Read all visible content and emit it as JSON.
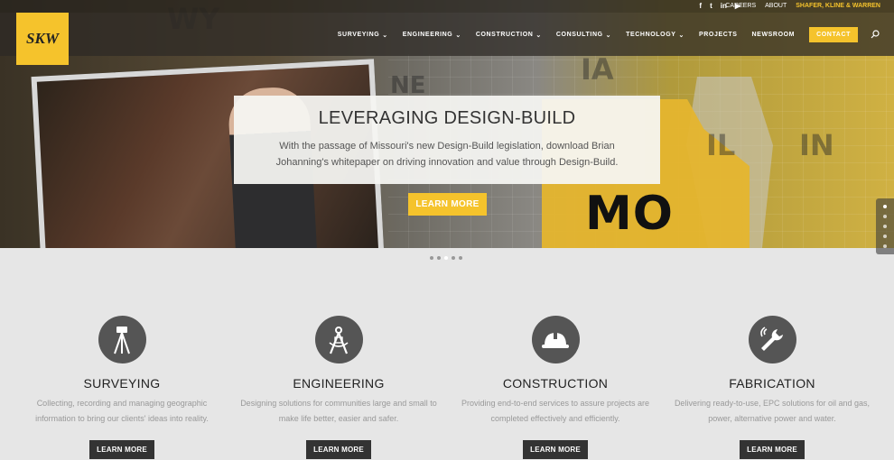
{
  "header": {
    "social_icons": [
      "facebook-icon",
      "twitter-icon",
      "linkedin-icon",
      "youtube-icon"
    ],
    "social_glyphs": [
      "f",
      "t",
      "in",
      "▶"
    ],
    "top_links": [
      "CAREERS",
      "ABOUT",
      "SHAFER, KLINE & WARREN"
    ],
    "logo_text": "SKW",
    "nav": [
      {
        "label": "SURVEYING",
        "dropdown": true
      },
      {
        "label": "ENGINEERING",
        "dropdown": true
      },
      {
        "label": "CONSTRUCTION",
        "dropdown": true
      },
      {
        "label": "CONSULTING",
        "dropdown": true
      },
      {
        "label": "TECHNOLOGY",
        "dropdown": true
      },
      {
        "label": "PROJECTS",
        "dropdown": false
      },
      {
        "label": "NEWSROOM",
        "dropdown": false
      }
    ],
    "contact_label": "CONTACT",
    "accent_color": "#f5c32c"
  },
  "hero": {
    "state_labels": [
      "WY",
      "NE",
      "IA",
      "IL",
      "IN"
    ],
    "mo_label": "MO",
    "title": "LEVERAGING DESIGN-BUILD",
    "text": "With the passage of Missouri's new Design-Build legislation, download Brian Johanning's whitepaper on driving innovation and value through Design-Build.",
    "button_label": "LEARN MORE",
    "slide_count": 5,
    "active_slide": 3
  },
  "services": [
    {
      "icon": "surveying-tripod-icon",
      "title": "SURVEYING",
      "text": "Collecting, recording and managing geographic information to bring our clients' ideas into reality.",
      "button": "LEARN MORE"
    },
    {
      "icon": "engineering-compass-icon",
      "title": "ENGINEERING",
      "text": "Designing solutions for communities large and small to make life better, easier and safer.",
      "button": "LEARN MORE"
    },
    {
      "icon": "hard-hat-icon",
      "title": "CONSTRUCTION",
      "text": "Providing end-to-end services to assure projects are completed effectively and efficiently.",
      "button": "LEARN MORE"
    },
    {
      "icon": "wrench-icon",
      "title": "FABRICATION",
      "text": "Delivering ready-to-use, EPC solutions for oil and gas, power, alternative power and water.",
      "button": "LEARN MORE"
    }
  ]
}
